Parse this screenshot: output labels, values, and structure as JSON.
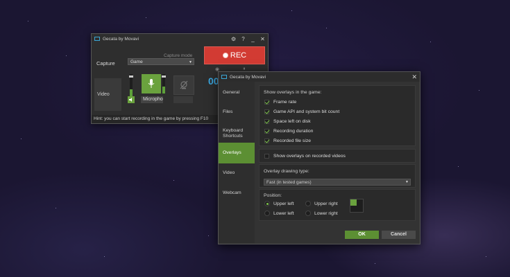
{
  "main_window": {
    "title": "Gecata by Movavi",
    "capture_label": "Capture",
    "capture_mode_label": "Capture mode",
    "capture_mode_value": "Game",
    "video_label": "Video",
    "microphone_select": "Microphone",
    "rec_label": "REC",
    "timer": "00",
    "hint": "Hint: you can start recording in the game by pressing F10"
  },
  "dialog": {
    "title": "Gecata by Movavi",
    "close_glyph": "✕",
    "sidebar": [
      {
        "label": "General",
        "active": false
      },
      {
        "label": "Files",
        "active": false
      },
      {
        "label": "Keyboard Shortcuts",
        "active": false
      },
      {
        "label": "Overlays",
        "active": true
      },
      {
        "label": "Video",
        "active": false
      },
      {
        "label": "Webcam",
        "active": false
      }
    ],
    "overlays_heading": "Show overlays in the game:",
    "overlay_options": [
      {
        "label": "Frame rate",
        "checked": true
      },
      {
        "label": "Game API and system bit count",
        "checked": true
      },
      {
        "label": "Space left on disk",
        "checked": true
      },
      {
        "label": "Recording duration",
        "checked": true
      },
      {
        "label": "Recorded file size",
        "checked": true
      }
    ],
    "show_on_recorded": {
      "label": "Show overlays on recorded videos",
      "checked": false
    },
    "drawing_type_label": "Overlay drawing type:",
    "drawing_type_value": "Fast (in tested games)",
    "position_label": "Position:",
    "positions": [
      {
        "label": "Upper left",
        "selected": true
      },
      {
        "label": "Upper right",
        "selected": false
      },
      {
        "label": "Lower left",
        "selected": false
      },
      {
        "label": "Lower right",
        "selected": false
      }
    ],
    "ok_label": "OK",
    "cancel_label": "Cancel"
  },
  "colors": {
    "accent_green": "#5c8f33",
    "rec_red": "#d23b33",
    "timer_blue": "#3aa7e0"
  }
}
